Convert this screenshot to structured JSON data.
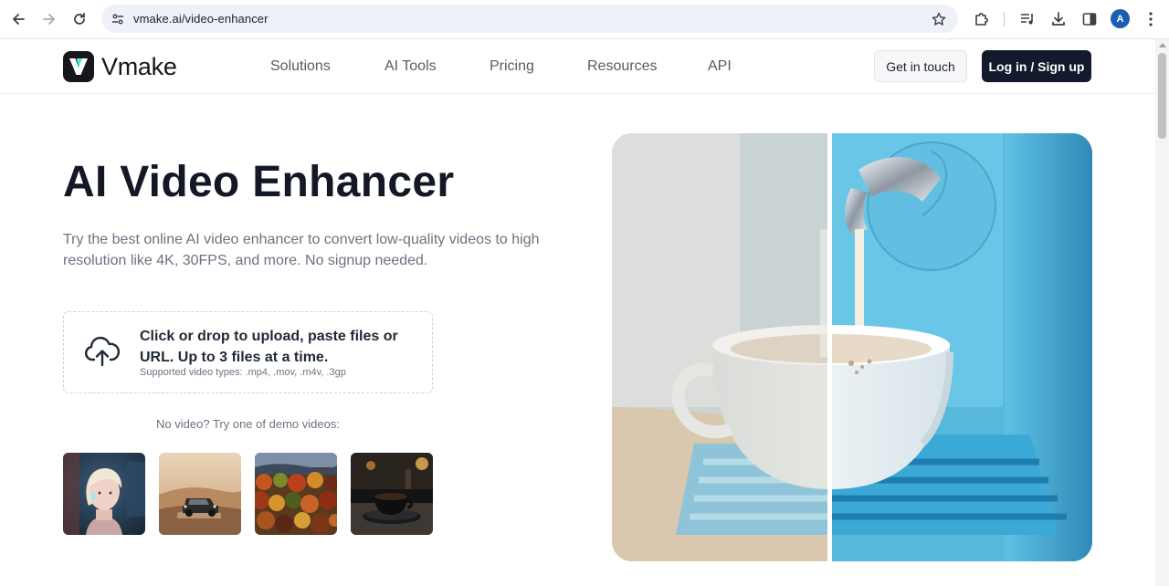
{
  "browser": {
    "url": "vmake.ai/video-enhancer",
    "profile_initial": "A"
  },
  "header": {
    "logo_text": "Vmake",
    "nav": [
      {
        "label": "Solutions"
      },
      {
        "label": "AI Tools"
      },
      {
        "label": "Pricing"
      },
      {
        "label": "Resources"
      },
      {
        "label": "API"
      }
    ],
    "get_in_touch": "Get in touch",
    "login": "Log in / Sign up"
  },
  "hero": {
    "title": "AI Video Enhancer",
    "subtitle": "Try the best online AI video enhancer to convert low-quality videos to high resolution like 4K, 30FPS, and more. No signup needed."
  },
  "upload": {
    "main_text": "Click or drop to upload, paste files or URL. Up to 3 files at a time.",
    "supported_types": "Supported video types: .mp4, .mov, .m4v, .3gp"
  },
  "demo": {
    "label": "No video? Try one of demo videos:",
    "thumbnails": [
      {
        "subject": "person-portrait"
      },
      {
        "subject": "car-in-desert"
      },
      {
        "subject": "autumn-forest"
      },
      {
        "subject": "coffee-cup"
      }
    ]
  },
  "colors": {
    "login_bg": "#121a2b",
    "title": "#121826",
    "compare_blue": "#56b5d9"
  },
  "icons": [
    "back-icon",
    "forward-icon",
    "reload-icon",
    "site-info-icon",
    "bookmark-star-icon",
    "extensions-icon",
    "media-controls-icon",
    "downloads-icon",
    "side-panel-icon",
    "more-menu-icon",
    "upload-cloud-icon"
  ]
}
